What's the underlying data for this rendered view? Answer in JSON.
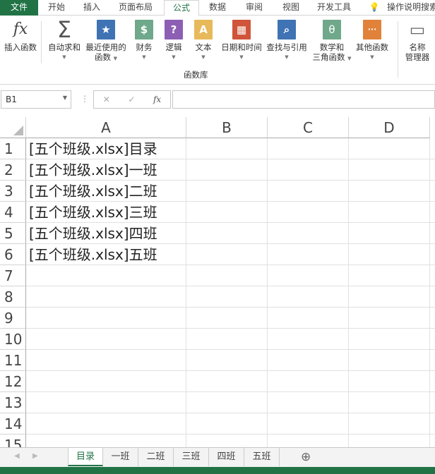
{
  "ribbon_tabs": [
    "文件",
    "开始",
    "插入",
    "页面布局",
    "公式",
    "数据",
    "审阅",
    "视图",
    "开发工具"
  ],
  "tell_me": "操作说明搜索",
  "buttons": [
    {
      "label": "插入函数",
      "label2": "",
      "icon": "fx-icon",
      "glyph": "fx",
      "color": "#ffffff"
    },
    {
      "label": "自动求和",
      "label2": "",
      "icon": "sum-icon",
      "glyph": "Σ",
      "color": "#ffffff"
    },
    {
      "label": "最近使用的",
      "label2": "函数",
      "icon": "recent-icon",
      "glyph": "★",
      "color": "#3f73b4"
    },
    {
      "label": "财务",
      "label2": "",
      "icon": "finance-icon",
      "glyph": "$",
      "color": "#6fa88a"
    },
    {
      "label": "逻辑",
      "label2": "",
      "icon": "logic-icon",
      "glyph": "?",
      "color": "#8c5fb4"
    },
    {
      "label": "文本",
      "label2": "",
      "icon": "text-icon",
      "glyph": "A",
      "color": "#e8b95a"
    },
    {
      "label": "日期和时间",
      "label2": "",
      "icon": "calendar-icon",
      "glyph": "▦",
      "color": "#d0543a"
    },
    {
      "label": "查找与引用",
      "label2": "",
      "icon": "lookup-icon",
      "glyph": "⌕",
      "color": "#3f73b4"
    },
    {
      "label": "数学和",
      "label2": "三角函数",
      "icon": "math-icon",
      "glyph": "θ",
      "color": "#6fa88a"
    },
    {
      "label": "其他函数",
      "label2": "",
      "icon": "more-functions-icon",
      "glyph": "···",
      "color": "#e0823a"
    },
    {
      "label": "名称",
      "label2": "管理器",
      "icon": "name-manager-icon",
      "glyph": "▭",
      "color": "#ffffff"
    }
  ],
  "group_label": "函数库",
  "name_box": "B1",
  "columns": [
    "A",
    "B",
    "C",
    "D"
  ],
  "rows": [
    "1",
    "2",
    "3",
    "4",
    "5",
    "6",
    "7",
    "8",
    "9",
    "10",
    "11",
    "12",
    "13",
    "14",
    "15"
  ],
  "cells": [
    "[五个班级.xlsx]目录",
    "[五个班级.xlsx]一班",
    "[五个班级.xlsx]二班",
    "[五个班级.xlsx]三班",
    "[五个班级.xlsx]四班",
    "[五个班级.xlsx]五班"
  ],
  "sheets": [
    "目录",
    "一班",
    "二班",
    "三班",
    "四班",
    "五班"
  ],
  "active_sheet": "目录"
}
